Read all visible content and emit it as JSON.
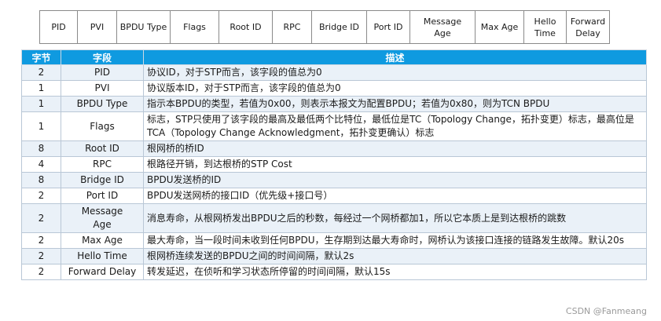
{
  "strip": [
    "PID",
    "PVI",
    "BPDU Type",
    "Flags",
    "Root ID",
    "RPC",
    "Bridge ID",
    "Port ID",
    "Message\nAge",
    "Max Age",
    "Hello\nTime",
    "Forward\nDelay"
  ],
  "table": {
    "headers": [
      "字节",
      "字段",
      "描述"
    ],
    "rows": [
      {
        "bytes": "2",
        "field": "PID",
        "desc": "协议ID，对于STP而言，该字段的值总为0"
      },
      {
        "bytes": "1",
        "field": "PVI",
        "desc": "协议版本ID，对于STP而言，该字段的值总为0"
      },
      {
        "bytes": "1",
        "field": "BPDU Type",
        "desc": "指示本BPDU的类型，若值为0x00，则表示本报文为配置BPDU；若值为0x80，则为TCN BPDU"
      },
      {
        "bytes": "1",
        "field": "Flags",
        "desc": "标志，STP只使用了该字段的最高及最低两个比特位，最低位是TC（Topology Change，拓扑变更）标志，最高位是TCA（Topology Change Acknowledgment，拓扑变更确认）标志"
      },
      {
        "bytes": "8",
        "field": "Root ID",
        "desc": "根网桥的桥ID"
      },
      {
        "bytes": "4",
        "field": "RPC",
        "desc": "根路径开销，到达根桥的STP Cost"
      },
      {
        "bytes": "8",
        "field": "Bridge ID",
        "desc": "BPDU发送桥的ID"
      },
      {
        "bytes": "2",
        "field": "Port ID",
        "desc": "BPDU发送网桥的接口ID（优先级+接口号）"
      },
      {
        "bytes": "2",
        "field": "Message\nAge",
        "desc": "消息寿命，从根网桥发出BPDU之后的秒数，每经过一个网桥都加1，所以它本质上是到达根桥的跳数"
      },
      {
        "bytes": "2",
        "field": "Max Age",
        "desc": "最大寿命，当一段时间未收到任何BPDU，生存期到达最大寿命时，网桥认为该接口连接的链路发生故障。默认20s"
      },
      {
        "bytes": "2",
        "field": "Hello Time",
        "desc": "根网桥连续发送的BPDU之间的时间间隔，默认2s"
      },
      {
        "bytes": "2",
        "field": "Forward Delay",
        "desc": "转发延迟，在侦听和学习状态所停留的时间间隔，默认15s"
      }
    ]
  },
  "watermark": "CSDN @Fanmeang"
}
